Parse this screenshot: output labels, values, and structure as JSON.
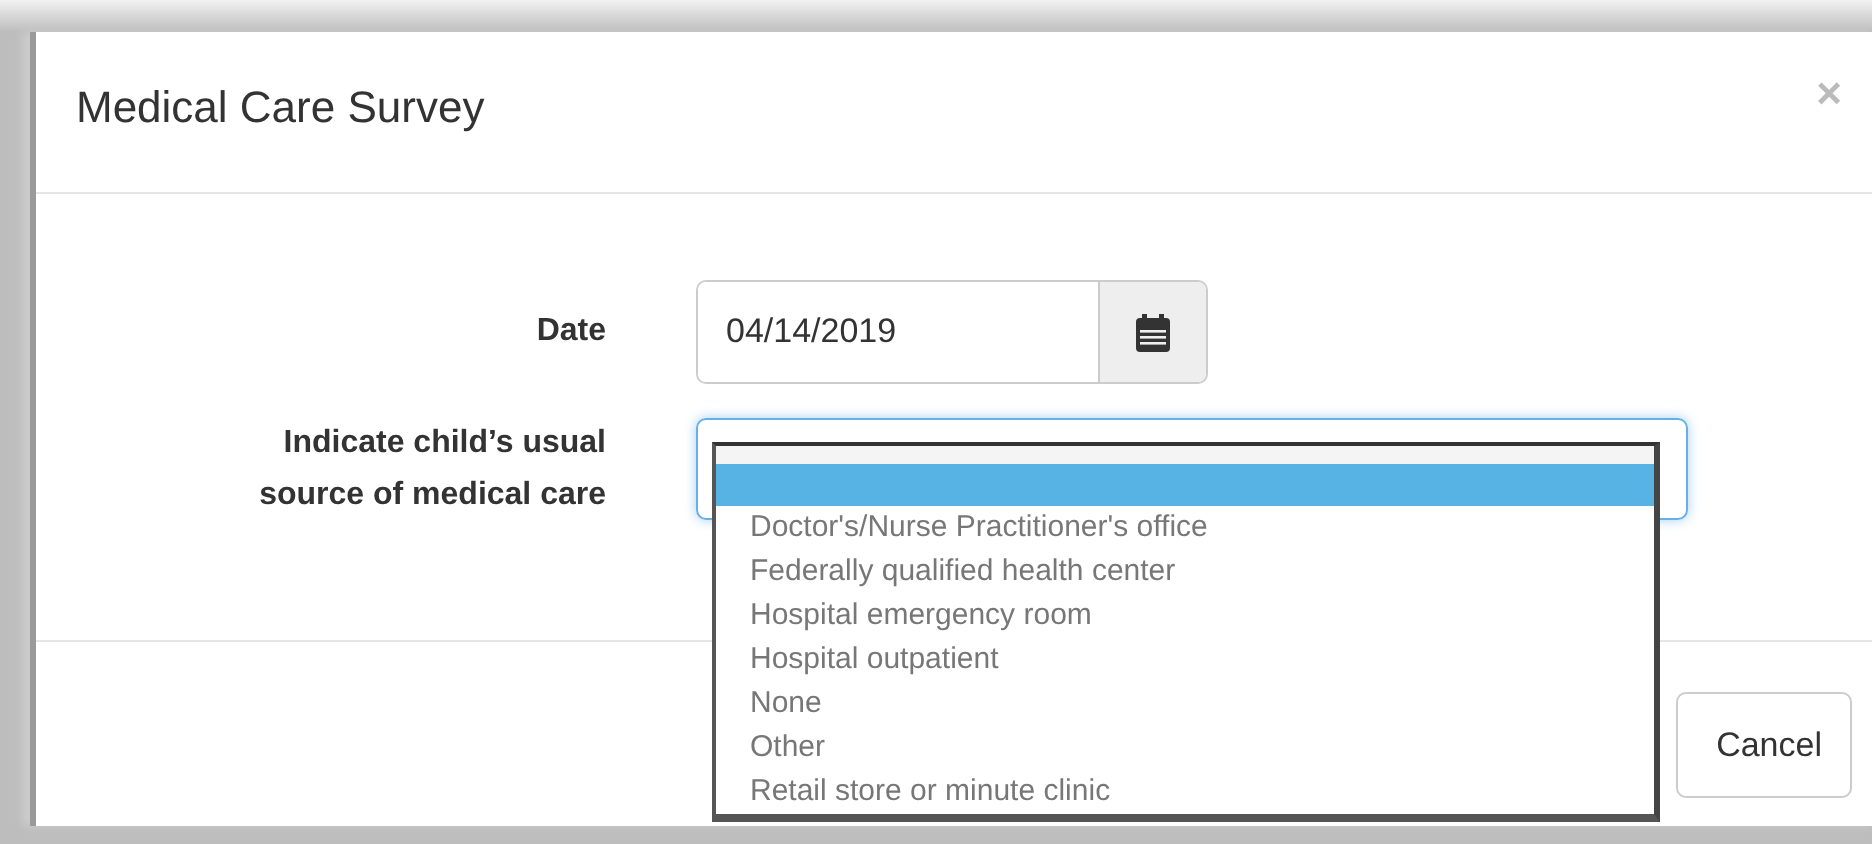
{
  "dialog": {
    "title": "Medical Care Survey",
    "close": "×"
  },
  "date_field": {
    "label": "Date",
    "value": "04/14/2019"
  },
  "care_source": {
    "label": "Indicate child’s usual source of medical care",
    "expanded": true,
    "blank_option": {
      "selected": true
    },
    "options": [
      {
        "label": "Doctor's/Nurse Practitioner's office",
        "selected": false
      },
      {
        "label": "Federally qualified health center",
        "selected": false
      },
      {
        "label": "Hospital emergency room",
        "selected": false
      },
      {
        "label": "Hospital outpatient",
        "selected": false
      },
      {
        "label": "None",
        "selected": false
      },
      {
        "label": "Other",
        "selected": false
      },
      {
        "label": "Retail store or minute clinic",
        "selected": false
      }
    ]
  },
  "buttons": [
    {
      "label": "Cancel"
    }
  ]
}
